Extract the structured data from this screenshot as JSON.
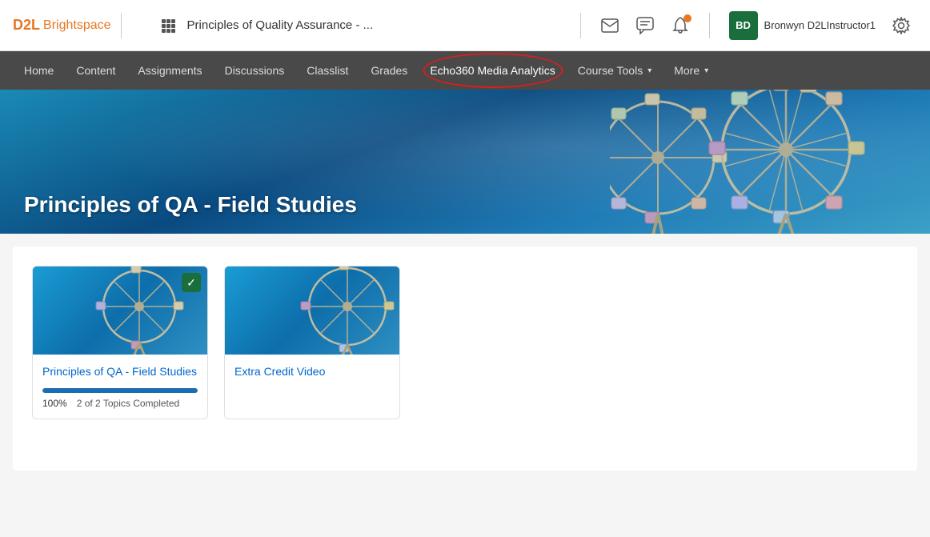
{
  "header": {
    "d2l_label": "D2L",
    "brightspace_label": "Brightspace",
    "course_title": "Principles of Quality Assurance - ...",
    "user_initials": "BD",
    "username": "Bronwyn D2LInstructor1"
  },
  "nav": {
    "items": [
      {
        "id": "home",
        "label": "Home"
      },
      {
        "id": "content",
        "label": "Content"
      },
      {
        "id": "assignments",
        "label": "Assignments"
      },
      {
        "id": "discussions",
        "label": "Discussions"
      },
      {
        "id": "classlist",
        "label": "Classlist"
      },
      {
        "id": "grades",
        "label": "Grades"
      },
      {
        "id": "echo360",
        "label": "Echo360 Media Analytics"
      },
      {
        "id": "course-tools",
        "label": "Course Tools",
        "has_dropdown": true
      },
      {
        "id": "more",
        "label": "More",
        "has_dropdown": true
      }
    ]
  },
  "hero": {
    "title": "Principles of QA - Field Studies"
  },
  "content": {
    "cards": [
      {
        "id": "card-1",
        "title": "Principles of QA - Field Studies",
        "completed": true,
        "progress_pct": 100,
        "progress_label": "100%",
        "topics_label": "2 of 2 Topics Completed"
      },
      {
        "id": "card-2",
        "title": "Extra Credit Video",
        "completed": false,
        "progress_pct": 0,
        "progress_label": "",
        "topics_label": ""
      }
    ]
  }
}
